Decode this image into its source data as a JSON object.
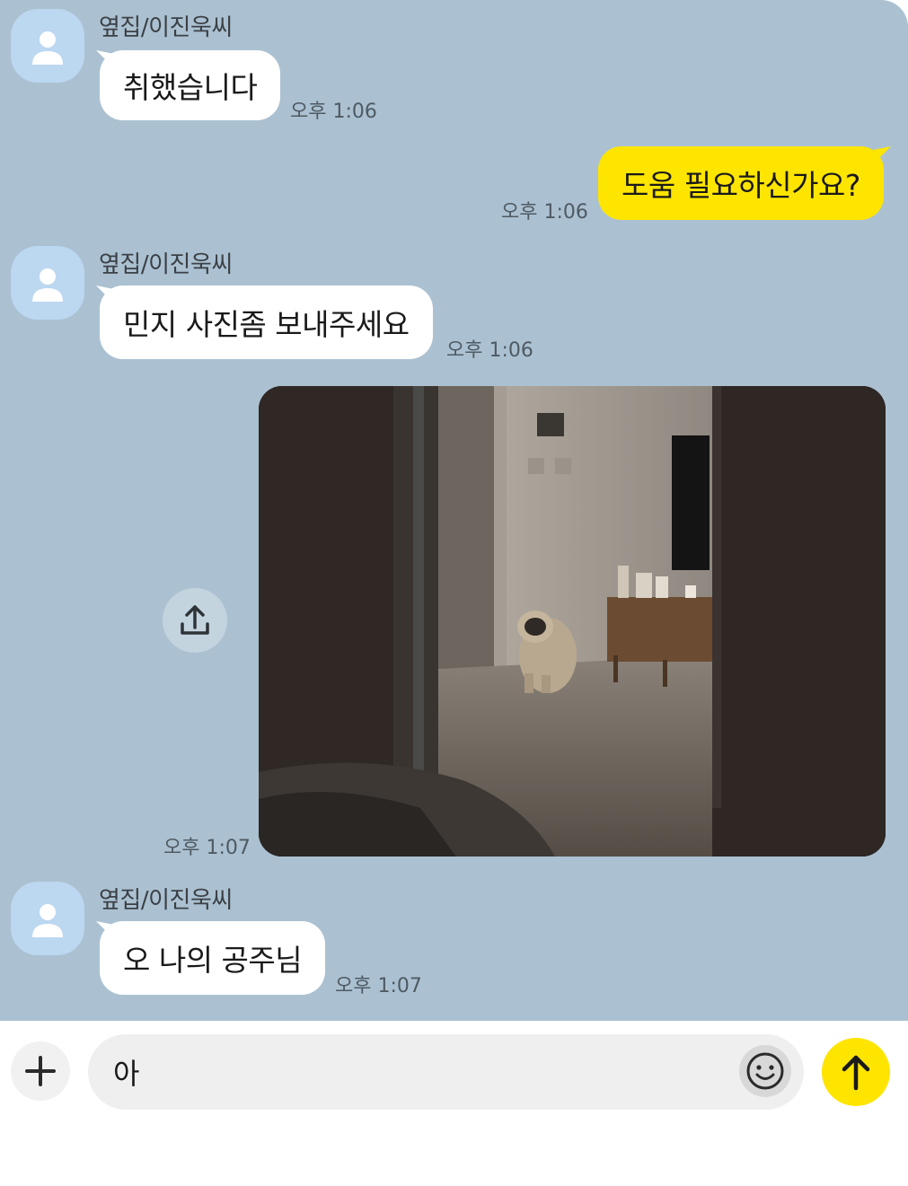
{
  "chat": {
    "background": "#abc1d1",
    "incoming_bubble_color": "#ffffff",
    "outgoing_bubble_color": "#fee500",
    "messages": [
      {
        "direction": "incoming",
        "sender": "옆집/이진욱씨",
        "text": "취했습니다",
        "time": "오후 1:06"
      },
      {
        "direction": "outgoing",
        "text": "도움 필요하신가요?",
        "time": "오후 1:06"
      },
      {
        "direction": "incoming",
        "sender": "옆집/이진욱씨",
        "text": "민지 사진좀 보내주세요",
        "time": "오후 1:06"
      },
      {
        "direction": "outgoing",
        "type": "photo",
        "photo_subject": "pug-sitting-in-hallway",
        "time": "오후 1:07"
      },
      {
        "direction": "incoming",
        "sender": "옆집/이진욱씨",
        "text": "오 나의 공주님",
        "time": "오후 1:07"
      }
    ]
  },
  "icons": {
    "avatar": "default-profile-icon",
    "share": "share-upload-icon",
    "plus": "plus-icon",
    "emoji": "emoji-smile-icon",
    "send": "send-arrow-icon"
  },
  "composer": {
    "value": "아",
    "send_color": "#fee500"
  }
}
